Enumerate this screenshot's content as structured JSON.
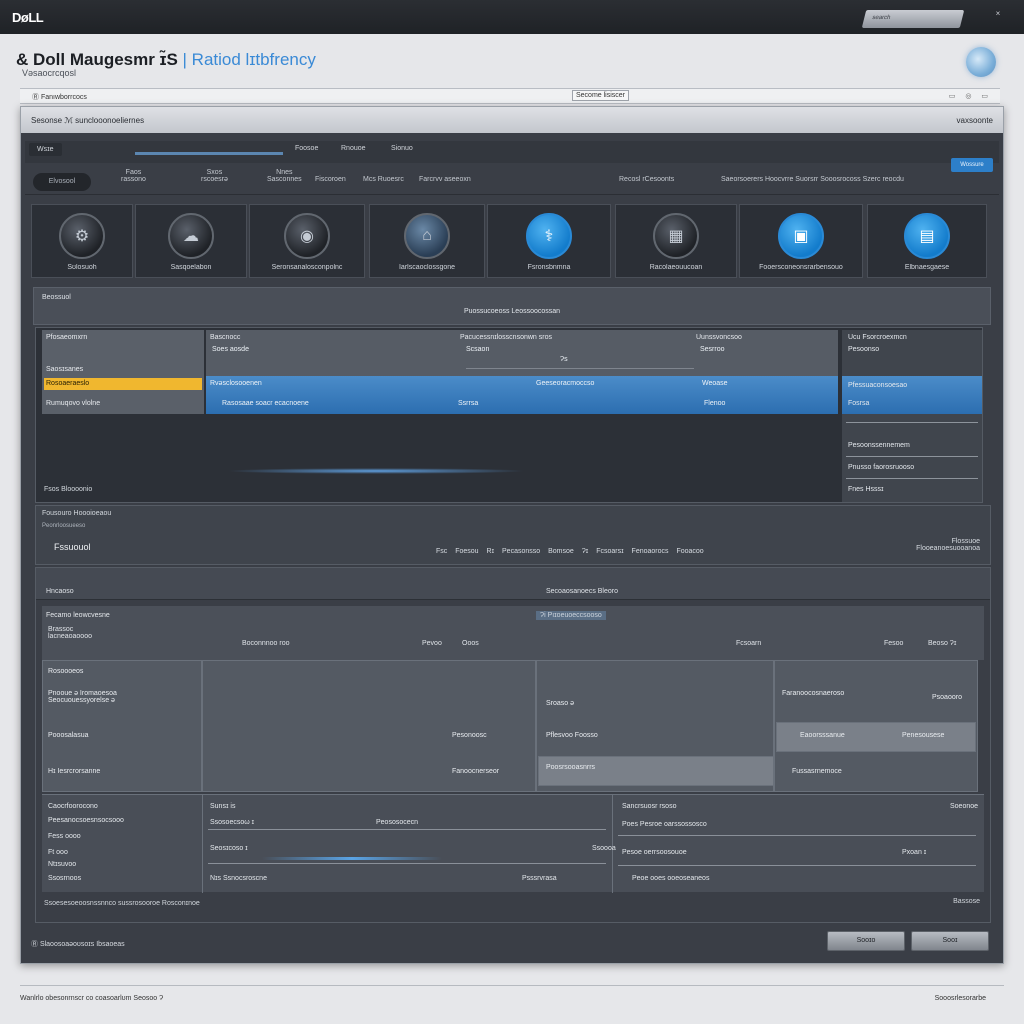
{
  "brand": {
    "logo": "DøLL"
  },
  "topbar": {
    "search_placeholder": "search",
    "close_label": "×"
  },
  "header": {
    "title_main": "& Doll Maugesmr ɪ̃S",
    "title_accent": "| Ratiod lɪtbfrency",
    "subtitle": "Vəsaocrcqosl"
  },
  "address_bar": {
    "left": "Ⓡ  Fanıwborrcocs",
    "middle": "Secome lisiscer",
    "right": "▭ ◎ ▭"
  },
  "window": {
    "title": "Sesonse  ℳ sunclooonoeliernes",
    "title_right": "vaxsoonte"
  },
  "tabs": [
    {
      "label": "Wsɪe",
      "active": true
    },
    {
      "label": "Foosoe"
    },
    {
      "label": "Rnouoe"
    },
    {
      "label": "Sionuo"
    }
  ],
  "toolbar": {
    "pill": "Elvosool",
    "items": [
      "Faos\nrassono",
      "Sxos\nrscoesrə",
      "Nnes\nSasconnes",
      "Fiscoroen",
      "Mcs Ruoesrc",
      "Farcrvv aseeoxn"
    ],
    "right_text": "Recosl rCesoonts",
    "right_text2": "Saeorsoerers Hoocvrre Suorsrr Sooosrocoss Szerc reocdu",
    "right_btn": "Wossure"
  },
  "tiles": [
    {
      "label": "Sʊlosuoh",
      "icon": "server-icon",
      "highlight": false
    },
    {
      "label": "Sasqoelabon",
      "icon": "cloud-hardware-icon",
      "highlight": false
    },
    {
      "label": "Seronsanalosconpolnc",
      "icon": "disk-icon",
      "highlight": false
    },
    {
      "label": "Iarlscaoclossgone",
      "icon": "network-icon",
      "highlight": false
    },
    {
      "label": "Fsronsbnmna",
      "icon": "management-icon",
      "highlight": true
    },
    {
      "label": "Racolaeouucoan",
      "icon": "storage-icon",
      "highlight": false
    },
    {
      "label": "Fooersconeonsrarbensouo",
      "icon": "monitor-icon",
      "highlight": true
    },
    {
      "label": "Elbnaesgaese",
      "icon": "device-icon",
      "highlight": true
    }
  ],
  "section": {
    "title": "Beossuol",
    "center": "Puossucoeoss Leossoocossan"
  },
  "region": {
    "left_rows": [
      "Pfosaeomxrn",
      "Saosɪsanes",
      "Rumuqovo vlolne"
    ],
    "left_highlight": "Rosoaeraeslo",
    "table_headers": [
      "Bascnocc",
      "Pacucessnɪlosscnsonwn sros",
      "Uunssvoncsoo"
    ],
    "table_rows": [
      [
        "Soes aosde",
        "Scsaon",
        "Sesrroo"
      ],
      [
        "",
        "Ɂs",
        ""
      ],
      [
        "Rvəsclosooenen",
        "Geeseoracmoccso",
        "Weoase"
      ],
      [
        "Rasosaae soacr ecacnoene",
        "Ssrrsa",
        "Flenoo"
      ]
    ],
    "right_rows": [
      "Ucu Fsorcroexmcn",
      "Pesoonso",
      "Pfessuaconsoesao",
      "Fosrsa",
      "Pesoonssennemem",
      "Pnusso faorosruooso",
      "Fnes Hsssɪ"
    ],
    "footer": "Fsos  Bloooonio"
  },
  "summary": {
    "line1": "Fousouro Hoooioeaou",
    "line2": "Peonrloosueeso",
    "big": "Fssuouol",
    "mid": "Fsc  Foesou  Rɪ  Pecasonsso  Bomsoe  Ɂɪ  Fcsoarsɪ  Fenoaorocs  Fooacoo",
    "right1": "Flossuoe",
    "right2": "Flooeanoesuooanoa"
  },
  "lower": {
    "bar_left": "Hncaoso",
    "bar_right": "Secoaosanoecs Bleoro",
    "sub_title": "Fecamo leowcvesne",
    "filter": "Ɂi  Pıɪoeuoeccsooso",
    "sub_cols": [
      "Brassoc\nlacneaoaoooo",
      "Boconnnoo roo",
      "Pevoo",
      "Ooos",
      "Fcsoarn",
      "Fesoo",
      "Beoso  Ɂɪ"
    ],
    "grid_left": [
      "Rosoooeos",
      "Pnooue ə Iromaoesoa\nSeocuouessyorelse ə",
      "Pooosalasua",
      "Hɪ Iesrcrorsanne"
    ],
    "grid_mid": [
      "Pesonoosc",
      "Fanoocnerseor",
      "Eaoorsssanue"
    ],
    "grid_right": [
      "Faranoocosnaeroso",
      "Sroaso ə",
      "Pflesvoo Foosso",
      "Poosrsooasnrrs"
    ],
    "grid_far": [
      "Psoaooro",
      "Penesousese",
      "Fussasrnemoce"
    ],
    "bottom_left": [
      "Caocrfoorocono",
      "Peesanocsoesnsocsooo",
      "Fess oooo",
      "Ft ooo",
      "Ntɪsuvoo",
      "Ssosrnoos"
    ],
    "bottom_mid": [
      "Sunsɪ is",
      "Ssosoecsoω  ɪ",
      "Peososocecn",
      "Seosɪcoso ɪ",
      "Nɪs  Ssnocsroscne",
      "Psssrvrasa",
      "Ssoooa"
    ],
    "bottom_right": [
      "Sancrsuosr  rsoso",
      "Soeonoe",
      "Poes  Pesroe oarssossosco",
      "Pesoe oerrsoosouoe",
      "Pxoan  ɪ",
      "Peoe ooes ooeoseaneos"
    ],
    "footer_left": "Ssoesesoeoosnssnnco  sussrosooroe  Rosconɪnoe",
    "footer_right": "Bassose"
  },
  "window_footer": {
    "text": "Ⓡ Slaoosoaəoʊsoɪs Ibsaoeas",
    "btn1": "Sooɪo",
    "btn2": "Sooɪ"
  },
  "page_footer": {
    "left": "Wanlrlo obesonrnscr co coasoarlʊm Seosoo Ɂ",
    "right": "Sooosrlesorarbe"
  }
}
